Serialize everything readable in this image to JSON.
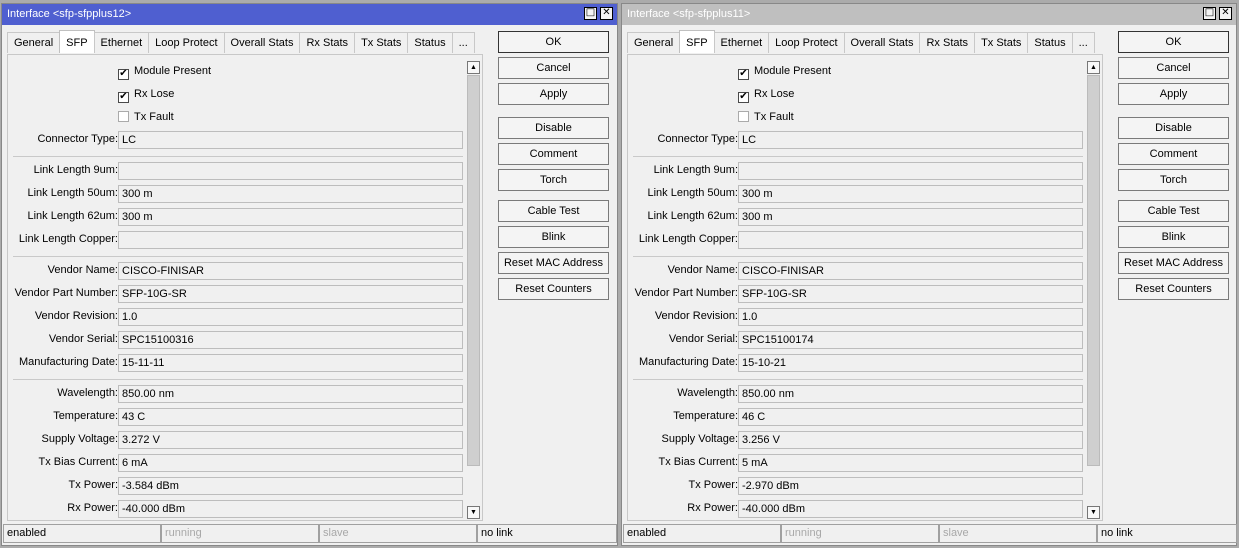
{
  "tabs": [
    "General",
    "SFP",
    "Ethernet",
    "Loop Protect",
    "Overall Stats",
    "Rx Stats",
    "Tx Stats",
    "Status",
    "..."
  ],
  "active_tab": "SFP",
  "buttons": [
    "OK",
    "Cancel",
    "Apply",
    "Disable",
    "Comment",
    "Torch",
    "Cable Test",
    "Blink",
    "Reset MAC Address",
    "Reset Counters"
  ],
  "labels": {
    "module_present": "Module Present",
    "rx_lose": "Rx Lose",
    "tx_fault": "Tx Fault",
    "connector_type": "Connector Type:",
    "link_length_9um": "Link Length 9um:",
    "link_length_50um": "Link Length 50um:",
    "link_length_62um": "Link Length 62um:",
    "link_length_copper": "Link Length Copper:",
    "vendor_name": "Vendor Name:",
    "vendor_part_number": "Vendor Part Number:",
    "vendor_revision": "Vendor Revision:",
    "vendor_serial": "Vendor Serial:",
    "manufacturing_date": "Manufacturing Date:",
    "wavelength": "Wavelength:",
    "temperature": "Temperature:",
    "supply_voltage": "Supply Voltage:",
    "tx_bias_current": "Tx Bias Current:",
    "tx_power": "Tx Power:",
    "rx_power": "Rx Power:"
  },
  "windows": [
    {
      "title": "Interface <sfp-sfpplus12>",
      "active": true,
      "checks": {
        "module_present": true,
        "rx_lose": true,
        "tx_fault": false
      },
      "fields": {
        "connector_type": "LC",
        "link_length_9um": "",
        "link_length_50um": "300 m",
        "link_length_62um": "300 m",
        "link_length_copper": "",
        "vendor_name": "CISCO-FINISAR",
        "vendor_part_number": "SFP-10G-SR",
        "vendor_revision": "1.0",
        "vendor_serial": "SPC15100316",
        "manufacturing_date": "15-11-11",
        "wavelength": "850.00 nm",
        "temperature": "43 C",
        "supply_voltage": "3.272 V",
        "tx_bias_current": "6 mA",
        "tx_power": "-3.584 dBm",
        "rx_power": "-40.000 dBm"
      },
      "status": [
        "enabled",
        "running",
        "slave",
        "no link"
      ]
    },
    {
      "title": "Interface <sfp-sfpplus11>",
      "active": false,
      "checks": {
        "module_present": true,
        "rx_lose": true,
        "tx_fault": false
      },
      "fields": {
        "connector_type": "LC",
        "link_length_9um": "",
        "link_length_50um": "300 m",
        "link_length_62um": "300 m",
        "link_length_copper": "",
        "vendor_name": "CISCO-FINISAR",
        "vendor_part_number": "SFP-10G-SR",
        "vendor_revision": "1.0",
        "vendor_serial": "SPC15100174",
        "manufacturing_date": "15-10-21",
        "wavelength": "850.00 nm",
        "temperature": "46 C",
        "supply_voltage": "3.256 V",
        "tx_bias_current": "5 mA",
        "tx_power": "-2.970 dBm",
        "rx_power": "-40.000 dBm"
      },
      "status": [
        "enabled",
        "running",
        "slave",
        "no link"
      ]
    }
  ],
  "colors": {
    "active_title": "#4f5fd0",
    "inactive_title": "#bfbfbf",
    "background": "#f0f0f0"
  },
  "icons": {
    "maximize": "maximize-icon",
    "close": "close-icon",
    "scroll_up": "scroll-up-icon",
    "scroll_down": "scroll-down-icon",
    "checkmark": "checkmark-icon"
  }
}
